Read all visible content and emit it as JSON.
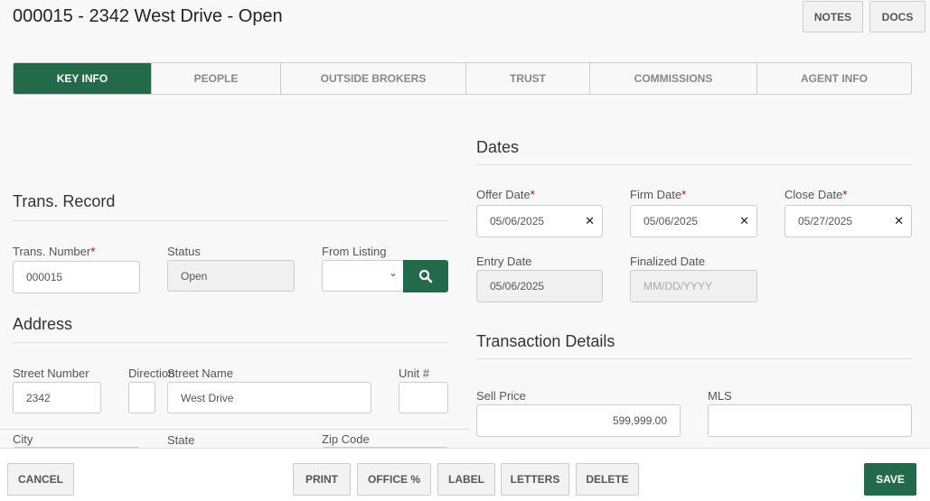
{
  "header": {
    "title": "000015 - 2342 West Drive - Open",
    "notes": "NOTES",
    "docs": "DOCS"
  },
  "tabs": [
    "KEY INFO",
    "PEOPLE",
    "OUTSIDE BROKERS",
    "TRUST",
    "COMMISSIONS",
    "AGENT INFO"
  ],
  "trans_record": {
    "heading": "Trans. Record",
    "number_label": "Trans. Number",
    "number": "000015",
    "status_label": "Status",
    "status": "Open",
    "listing_label": "From Listing",
    "listing": ""
  },
  "address": {
    "heading": "Address",
    "street_number_label": "Street Number",
    "street_number": "2342",
    "direction_label": "Direction",
    "street_name_label": "Street Name",
    "street_name": "West Drive",
    "unit_label": "Unit #",
    "city_label": "City",
    "state_label": "State",
    "zip_label": "Zip Code"
  },
  "dates": {
    "heading": "Dates",
    "offer_label": "Offer Date",
    "offer": "05/06/2025",
    "firm_label": "Firm Date",
    "firm": "05/06/2025",
    "close_label": "Close Date",
    "close": "05/27/2025",
    "entry_label": "Entry Date",
    "entry": "05/06/2025",
    "finalized_label": "Finalized Date",
    "finalized_placeholder": "MM/DD/YYYY"
  },
  "details": {
    "heading": "Transaction Details",
    "sell_price_label": "Sell Price",
    "sell_price": "599,999.00",
    "mls_label": "MLS",
    "mls": ""
  },
  "required_mark": "*",
  "footer": {
    "cancel": "CANCEL",
    "print": "PRINT",
    "office": "OFFICE %",
    "label": "LABEL",
    "letters": "LETTERS",
    "delete": "DELETE",
    "save": "SAVE"
  },
  "colors": {
    "accent": "#236a4a",
    "required": "#cc0000"
  }
}
